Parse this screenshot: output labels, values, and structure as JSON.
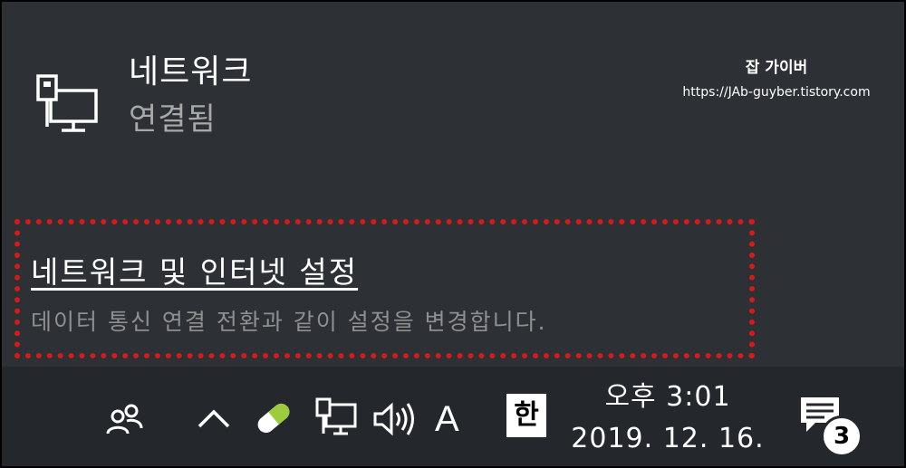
{
  "flyout": {
    "network": {
      "title": "네트워크",
      "status": "연결됨",
      "icon": "ethernet-monitor-icon"
    },
    "watermark": {
      "title": "잡 가이버",
      "url": "https://JAb-guyber.tistory.com"
    },
    "settings": {
      "link_label": "네트워크 및 인터넷 설정",
      "description": "데이터 통신 연결 전환과 같이 설정을 변경합니다.",
      "highlight_color": "#d51a1a"
    }
  },
  "taskbar": {
    "icons": [
      "people-icon",
      "chevron-up-icon",
      "battery-pill-icon",
      "network-icon",
      "volume-icon"
    ],
    "language": "A",
    "ime": "한",
    "clock": {
      "time": "오후 3:01",
      "date": "2019. 12. 16."
    },
    "notifications": {
      "icon": "action-center-icon",
      "count": "3"
    }
  }
}
